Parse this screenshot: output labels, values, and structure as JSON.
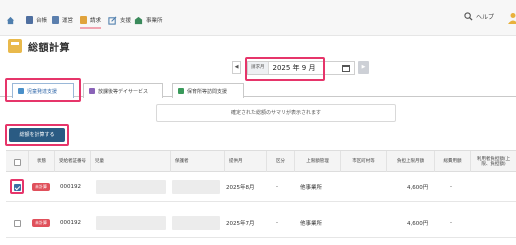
{
  "nav": {
    "items": [
      {
        "label": "",
        "icon": "home-icon"
      },
      {
        "label": "台帳",
        "icon": "ledger-icon"
      },
      {
        "label": "運営",
        "icon": "operation-icon"
      },
      {
        "label": "請求",
        "icon": "billing-icon"
      },
      {
        "label": "支援",
        "icon": "support-icon"
      },
      {
        "label": "事業所",
        "icon": "office-icon"
      }
    ],
    "help": "ヘルプ"
  },
  "page": {
    "title": "総額計算"
  },
  "month": {
    "label": "請求月",
    "value": "2025 年 9 月",
    "prev": "◀",
    "next": "▶"
  },
  "tabs": [
    {
      "label": "児童発達支援",
      "color": "#4a90c9"
    },
    {
      "label": "放課後等デイサービス",
      "color": "#8a63b8"
    },
    {
      "label": "保育所等訪問支援",
      "color": "#3a9a5b"
    }
  ],
  "notice": "確定された総額のサマリが表示されます",
  "calc_button": "総額を計算する",
  "table": {
    "headers": [
      "",
      "状態",
      "受給者証番号",
      "児童",
      "保護者",
      "提供月",
      "区分",
      "上限額管理",
      "市区町村等",
      "負担上限月額",
      "総費用額",
      "利用者負担額(上限、負担額)"
    ],
    "rows": [
      {
        "checked": true,
        "status": "未計算",
        "number": "000192",
        "month": "2025年8月",
        "category": "-",
        "limit": "他事業所",
        "city": "",
        "cap": "4,600円",
        "total": "-"
      },
      {
        "checked": false,
        "status": "未計算",
        "number": "000192",
        "month": "2025年7月",
        "category": "-",
        "limit": "他事業所",
        "city": "",
        "cap": "4,600円",
        "total": "-"
      }
    ]
  }
}
